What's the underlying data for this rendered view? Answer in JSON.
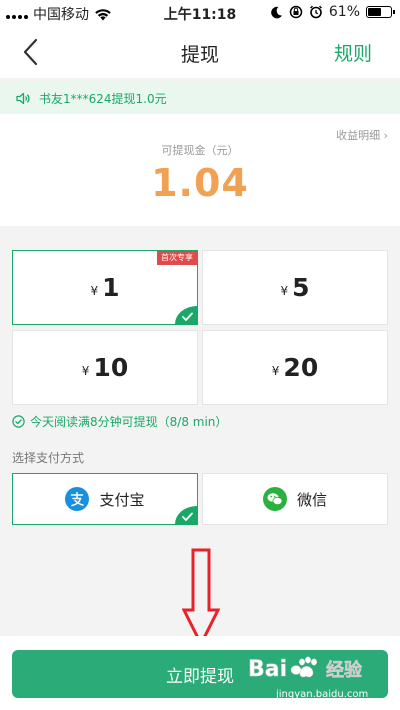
{
  "statusbar": {
    "carrier": "中国移动",
    "time": "上午11:18",
    "battery": "61%",
    "battery_level": 0.61
  },
  "navbar": {
    "title": "提现",
    "rules_label": "规则"
  },
  "notice": {
    "text": "书友1***624提现1.0元"
  },
  "balance": {
    "detail_link": "收益明细 ›",
    "label": "可提现金（元）",
    "value": "1.04"
  },
  "amounts": [
    {
      "currency": "¥",
      "value": "1",
      "tag": "首次专享",
      "selected": true
    },
    {
      "currency": "¥",
      "value": "5",
      "tag": "",
      "selected": false
    },
    {
      "currency": "¥",
      "value": "10",
      "tag": "",
      "selected": false
    },
    {
      "currency": "¥",
      "value": "20",
      "tag": "",
      "selected": false
    }
  ],
  "read_tip": "今天阅读满8分钟可提现（8/8 min）",
  "payment": {
    "label": "选择支付方式",
    "methods": [
      {
        "name": "支付宝",
        "icon": "alipay-icon",
        "selected": true
      },
      {
        "name": "微信",
        "icon": "wechat-icon",
        "selected": false
      }
    ]
  },
  "submit_label": "立即提现",
  "watermark": {
    "brand": "Bai",
    "brand_suffix": "经验",
    "url": "jingyan.baidu.com"
  },
  "colors": {
    "accent": "#1aa869",
    "button": "#2aab78",
    "balance": "#f0a152",
    "tag": "#e04a4a",
    "arrow": "#e8212a"
  }
}
